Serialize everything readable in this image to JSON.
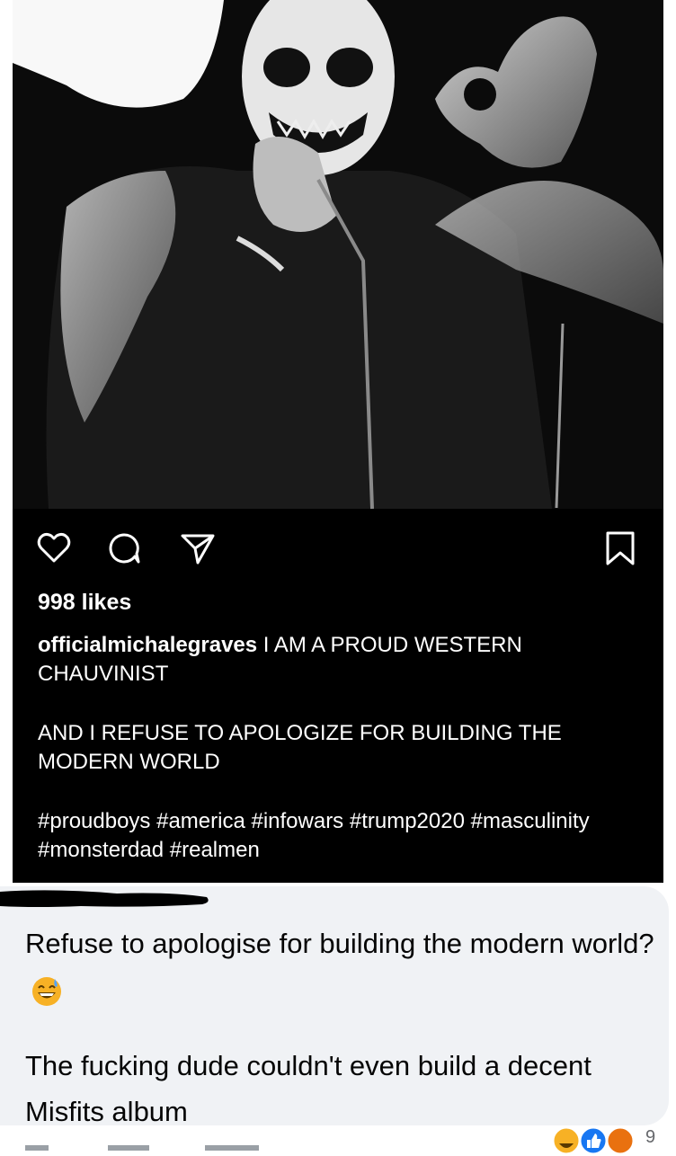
{
  "post": {
    "likes": "998 likes",
    "username": "officialmichalegraves",
    "caption_line1": "I AM A PROUD WESTERN CHAUVINIST",
    "caption_line2": "AND I REFUSE TO APOLOGIZE FOR BUILDING THE MODERN WORLD",
    "hashtags": "#proudboys #america #infowars #trump2020 #masculinity #monsterdad #realmen",
    "icons": [
      "heart-icon",
      "comment-icon",
      "share-icon",
      "bookmark-icon"
    ]
  },
  "comment": {
    "text_line1": "Refuse to apologise for building the modern world?",
    "emoji": "grinning-sweat-emoji",
    "text_line2": "The fucking dude couldn't even build a decent Misfits album",
    "reaction_icons": [
      "haha-reaction-icon",
      "like-reaction-icon",
      "angry-reaction-icon"
    ],
    "reaction_count": "9"
  },
  "colors": {
    "post_background": "#000000",
    "comment_bubble": "#f0f2f5",
    "text_light": "#ffffff",
    "text_dark": "#050505",
    "muted": "#65676b",
    "like_blue": "#1877f2",
    "angry_orange": "#e9710f",
    "haha_yellow": "#f7b125"
  }
}
